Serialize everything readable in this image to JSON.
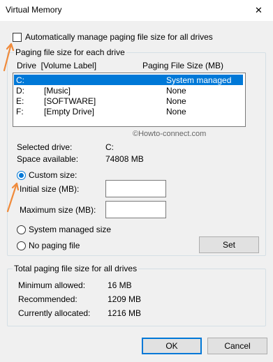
{
  "window": {
    "title": "Virtual Memory",
    "close_glyph": "✕"
  },
  "auto_manage": {
    "label": "Automatically manage paging file size for all drives",
    "checked": false
  },
  "paging_group": {
    "legend": "Paging file size for each drive",
    "col_drive": "Drive  [Volume Label]",
    "col_size": "Paging File Size (MB)",
    "drives": [
      {
        "drive": "C:",
        "label": "",
        "size": "System managed",
        "selected": true
      },
      {
        "drive": "D:",
        "label": "[Music]",
        "size": "None",
        "selected": false
      },
      {
        "drive": "E:",
        "label": "[SOFTWARE]",
        "size": "None",
        "selected": false
      },
      {
        "drive": "F:",
        "label": "[Empty Drive]",
        "size": "None",
        "selected": false
      }
    ],
    "watermark": "©Howto-connect.com",
    "selected_drive_label": "Selected drive:",
    "selected_drive_value": "C:",
    "space_available_label": "Space available:",
    "space_available_value": "74808 MB",
    "custom_size_label": "Custom size:",
    "initial_size_label": "Initial size (MB):",
    "initial_size_value": "",
    "maximum_size_label": "Maximum size (MB):",
    "maximum_size_value": "",
    "system_managed_label": "System managed size",
    "no_paging_label": "No paging file",
    "set_button": "Set",
    "selected_option": "custom"
  },
  "total_group": {
    "legend": "Total paging file size for all drives",
    "min_label": "Minimum allowed:",
    "min_value": "16 MB",
    "recommended_label": "Recommended:",
    "recommended_value": "1209 MB",
    "allocated_label": "Currently allocated:",
    "allocated_value": "1216 MB"
  },
  "buttons": {
    "ok": "OK",
    "cancel": "Cancel"
  },
  "colors": {
    "accent": "#0078d7",
    "annotation_arrow": "#f08a3a"
  }
}
